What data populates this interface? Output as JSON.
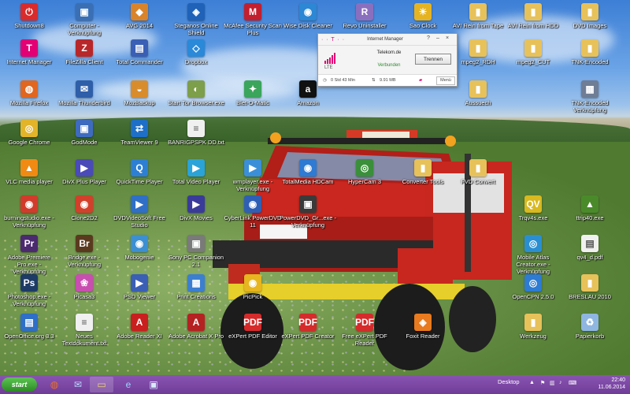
{
  "desktop_icons": [
    {
      "label": "Shutdown8",
      "icon": "power-icon",
      "color": "#d92b2b",
      "glyph": "⏻"
    },
    {
      "label": "Computer - Verknüpfung",
      "icon": "computer-icon",
      "color": "#3a6fb5",
      "glyph": "▣"
    },
    {
      "label": "AVG 2014",
      "icon": "avg-icon",
      "color": "#d9832b",
      "glyph": "◆"
    },
    {
      "label": "Steganos Online Shield",
      "icon": "shield-icon",
      "color": "#1f62b8",
      "glyph": "◈"
    },
    {
      "label": "McAfee Security Scan Plus",
      "icon": "mcafee-icon",
      "color": "#c21f2f",
      "glyph": "M"
    },
    {
      "label": "Wise Disk Cleaner",
      "icon": "disk-cleaner-icon",
      "color": "#2c87d4",
      "glyph": "◉"
    },
    {
      "label": "Revo Uninstaller",
      "icon": "revo-icon",
      "color": "#8a6fbf",
      "glyph": "R"
    },
    {
      "label": "Sao Clock",
      "icon": "clock-icon",
      "color": "#e6b422",
      "glyph": "☀"
    },
    {
      "label": "AVI Rein from Tape",
      "icon": "folder-icon",
      "color": "#e7c15a",
      "glyph": "▮"
    },
    {
      "label": "AVI Rein from HDD",
      "icon": "folder-icon",
      "color": "#e7c15a",
      "glyph": "▮"
    },
    {
      "label": "DVD Images",
      "icon": "folder-icon",
      "color": "#e7c15a",
      "glyph": "▮"
    },
    {
      "label": "Internet Manager",
      "icon": "internet-manager-icon",
      "color": "#e20074",
      "glyph": "T"
    },
    {
      "label": "FileZilla Client",
      "icon": "filezilla-icon",
      "color": "#b8272a",
      "glyph": "Z"
    },
    {
      "label": "Total Commander",
      "icon": "total-commander-icon",
      "color": "#3a5fb5",
      "glyph": "▤"
    },
    {
      "label": "Dropbox",
      "icon": "dropbox-icon",
      "color": "#2a89d8",
      "glyph": "◇"
    },
    {
      "label": "mpeg2_RDH",
      "icon": "folder-icon",
      "color": "#e7c15a",
      "glyph": "▮"
    },
    {
      "label": "mpeg2_CUT",
      "icon": "folder-icon",
      "color": "#e7c15a",
      "glyph": "▮"
    },
    {
      "label": "TNK-Encoded",
      "icon": "folder-icon",
      "color": "#e7c15a",
      "glyph": "▮"
    },
    {
      "label": "Mozilla Firefox",
      "icon": "firefox-icon",
      "color": "#e1661f",
      "glyph": "◍"
    },
    {
      "label": "Mozilla Thunderbird",
      "icon": "thunderbird-icon",
      "color": "#2f5fa8",
      "glyph": "✉"
    },
    {
      "label": "MozBackup",
      "icon": "mozbackup-icon",
      "color": "#d98c2b",
      "glyph": "◒"
    },
    {
      "label": "Start Tor Browser.exe",
      "icon": "tor-icon",
      "color": "#7d9e4a",
      "glyph": "◐"
    },
    {
      "label": "Blet-O-Matic",
      "icon": "blet-icon",
      "color": "#3aa55b",
      "glyph": "✦"
    },
    {
      "label": "Amazon",
      "icon": "amazon-icon",
      "color": "#111111",
      "glyph": "a"
    },
    {
      "label": "Aussuech",
      "icon": "folder-icon",
      "color": "#e7c15a",
      "glyph": "▮"
    },
    {
      "label": "TNK-Encoded Verknüpfung",
      "icon": "tnk-shortcut-icon",
      "color": "#6f7d95",
      "glyph": "▦"
    },
    {
      "label": "Google Chrome",
      "icon": "chrome-icon",
      "color": "#e2b42a",
      "glyph": "◎"
    },
    {
      "label": "GodMode",
      "icon": "godmode-icon",
      "color": "#3f6bbf",
      "glyph": "▣"
    },
    {
      "label": "TeamViewer 9",
      "icon": "teamviewer-icon",
      "color": "#1e6fc7",
      "glyph": "⇄"
    },
    {
      "label": "BANRIGPSPK DD.txt",
      "icon": "text-file-icon",
      "color": "#f0f0f0",
      "glyph": "≡"
    },
    {
      "label": "VLC media player",
      "icon": "vlc-icon",
      "color": "#f08a12",
      "glyph": "▲"
    },
    {
      "label": "DivX Plus Player",
      "icon": "divx-icon",
      "color": "#4a4ab8",
      "glyph": "▶"
    },
    {
      "label": "QuickTime Player",
      "icon": "quicktime-icon",
      "color": "#2d7fd3",
      "glyph": "Q"
    },
    {
      "label": "Total Video Player",
      "icon": "total-video-icon",
      "color": "#2aa3d8",
      "glyph": "▶"
    },
    {
      "label": "wmplayer.exe - Verknüpfung",
      "icon": "wmplayer-icon",
      "color": "#3b8fd8",
      "glyph": "▶"
    },
    {
      "label": "TotalMedia HDCam",
      "icon": "hdcam-icon",
      "color": "#2f7ad2",
      "glyph": "◉"
    },
    {
      "label": "HyperCam 3",
      "icon": "hypercam-icon",
      "color": "#3a8f3a",
      "glyph": "◎"
    },
    {
      "label": "Converter Tools",
      "icon": "folder-icon",
      "color": "#e7c15a",
      "glyph": "▮"
    },
    {
      "label": "FVD Convert",
      "icon": "folder-icon",
      "color": "#e7c15a",
      "glyph": "▮"
    },
    {
      "label": "burningstudio.exe - Verknüpfung",
      "icon": "burning-studio-icon",
      "color": "#d23b2b",
      "glyph": "◉"
    },
    {
      "label": "Clone2D2",
      "icon": "clone-icon",
      "color": "#d2402b",
      "glyph": "◉"
    },
    {
      "label": "DVDVideoSoft Free Studio",
      "icon": "dvdvideosoft-icon",
      "color": "#2f6fc7",
      "glyph": "▶"
    },
    {
      "label": "DivX Movies",
      "icon": "divx-movies-icon",
      "color": "#3a3a9a",
      "glyph": "▶"
    },
    {
      "label": "CyberLink PowerDVD 11",
      "icon": "powerdvd-icon",
      "color": "#2f5fb5",
      "glyph": "◉"
    },
    {
      "label": "PowerDVD_Gr...exe - Verknüpfung",
      "icon": "powerdvd-shortcut-icon",
      "color": "#3a3a3a",
      "glyph": "▣"
    },
    {
      "label": "Trqv4s.exe",
      "icon": "trqv-icon",
      "color": "#d8b91f",
      "glyph": "QV"
    },
    {
      "label": "ttrip40.exe",
      "icon": "ttrip-icon",
      "color": "#4a8a2a",
      "glyph": "▲"
    },
    {
      "label": "Adobe Premiere Pro.exe - Verknüpfung",
      "icon": "premiere-icon",
      "color": "#4b2a6f",
      "glyph": "Pr"
    },
    {
      "label": "Bridge.exe - Verknüpfung",
      "icon": "bridge-icon",
      "color": "#5a3a1f",
      "glyph": "Br"
    },
    {
      "label": "Mobogenie",
      "icon": "mobogenie-icon",
      "color": "#3c8fd3",
      "glyph": "◉"
    },
    {
      "label": "Sony PC Companion 2.1",
      "icon": "sony-icon",
      "color": "#7a7a7a",
      "glyph": "▣"
    },
    {
      "label": "Mobile Atlas Creator.exe - Verknüpfung",
      "icon": "atlas-icon",
      "color": "#2a8fd2",
      "glyph": "◎"
    },
    {
      "label": "qv4_d.pdf",
      "icon": "pdf-file-icon",
      "color": "#f0f0f0",
      "glyph": "▤"
    },
    {
      "label": "Photoshop.exe - Verknüpfung",
      "icon": "photoshop-icon",
      "color": "#1d3b66",
      "glyph": "Ps"
    },
    {
      "label": "Picasa3",
      "icon": "picasa-icon",
      "color": "#c84fb0",
      "glyph": "❀"
    },
    {
      "label": "PSD Viewer",
      "icon": "psd-viewer-icon",
      "color": "#3a5fb5",
      "glyph": "▶"
    },
    {
      "label": "Print Creations",
      "icon": "print-icon",
      "color": "#3c7fd0",
      "glyph": "▦"
    },
    {
      "label": "PicPick",
      "icon": "picpick-icon",
      "color": "#e7b51f",
      "glyph": "◉"
    },
    {
      "label": "OpenCPN 2.5.0",
      "icon": "opencpn-icon",
      "color": "#2d7bd2",
      "glyph": "◎"
    },
    {
      "label": "BRESLAU 2010",
      "icon": "folder-icon",
      "color": "#e7c15a",
      "glyph": "▮"
    },
    {
      "label": "OpenOffice.org 3.3",
      "icon": "openoffice-icon",
      "color": "#2f6fc7",
      "glyph": "▤"
    },
    {
      "label": "Neues Textdokument.txt",
      "icon": "text-file-icon",
      "color": "#f0f0f0",
      "glyph": "≡"
    },
    {
      "label": "Adobe Reader XI",
      "icon": "adobe-reader-icon",
      "color": "#c91f1f",
      "glyph": "A"
    },
    {
      "label": "Adobe Acrobat X Pro",
      "icon": "acrobat-icon",
      "color": "#b52222",
      "glyph": "A"
    },
    {
      "label": "eXPert PDF Editor",
      "icon": "expert-pdf-editor-icon",
      "color": "#d52b2b",
      "glyph": "PDF"
    },
    {
      "label": "eXPert PDF Creator",
      "icon": "expert-pdf-creator-icon",
      "color": "#d52b2b",
      "glyph": "PDF"
    },
    {
      "label": "Free eXPert PDF Reader",
      "icon": "expert-pdf-reader-icon",
      "color": "#d52b2b",
      "glyph": "PDF"
    },
    {
      "label": "Foxit Reader",
      "icon": "foxit-icon",
      "color": "#e87a1f",
      "glyph": "◈"
    },
    {
      "label": "Werkzeug",
      "icon": "folder-icon",
      "color": "#e7c15a",
      "glyph": "▮"
    },
    {
      "label": "Papierkorb",
      "icon": "recycle-bin-icon",
      "color": "#8fb6e0",
      "glyph": "♻"
    }
  ],
  "internet_manager": {
    "title": "Internet Manager",
    "brand": "· · T · ·",
    "help": "?",
    "minimize": "–",
    "close": "×",
    "network": "Telekom.de",
    "connection_type": "LTE",
    "status": "Verbunden",
    "disconnect_label": "Trennen",
    "duration": "0 Std 43 Min",
    "data_volume": "9.91 MB",
    "menu_label": "Menü"
  },
  "taskbar": {
    "start_label": "start",
    "apps": [
      {
        "name": "firefox",
        "glyph": "◍",
        "color": "#e8712a"
      },
      {
        "name": "thunderbird",
        "glyph": "✉",
        "color": "#bcd6ff"
      },
      {
        "name": "file-explorer",
        "glyph": "▭",
        "color": "#f0d27a"
      },
      {
        "name": "internet-explorer",
        "glyph": "e",
        "color": "#9fd2ff"
      },
      {
        "name": "control-panel",
        "glyph": "▣",
        "color": "#d9eaff"
      }
    ],
    "desktop_label": "Desktop",
    "time": "22:40",
    "date": "11.06.2014"
  }
}
